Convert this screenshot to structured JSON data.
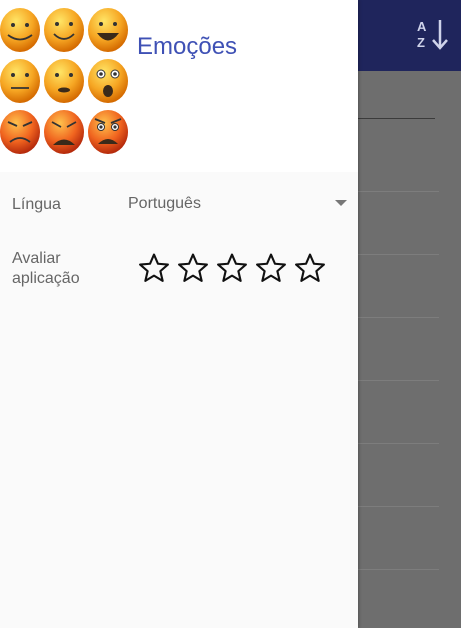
{
  "app": {
    "title": "Emoções",
    "sort_icon": "sort-az-icon"
  },
  "settings": {
    "language": {
      "label": "Língua",
      "value": "Português",
      "icon": "dropdown-arrow-icon"
    },
    "rate": {
      "label_line1": "Avaliar",
      "label_line2": "aplicação",
      "stars_total": 5,
      "stars_filled": 0,
      "icon": "star-outline-icon"
    }
  },
  "colors": {
    "app_bar": "#1f255c",
    "title": "#3f51b5",
    "face_orange": "#f08a1a",
    "face_red": "#e24a1a"
  }
}
